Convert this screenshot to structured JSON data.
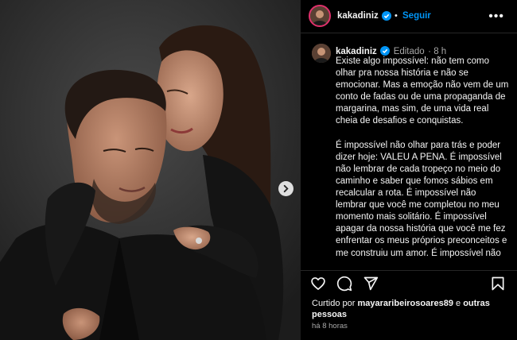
{
  "post": {
    "username": "kakadiniz",
    "follow_label": "Seguir",
    "more_label": "•••",
    "edited_label": "Editado",
    "time_ago": "8 h",
    "caption": "Existe algo impossível: não tem como olhar pra nossa história e não se emocionar. Mas a emoção não vem de um conto de fadas ou de uma propaganda de margarina, mas sim, de uma vida real cheia de desafios e conquistas.\n\nÉ impossível não olhar para trás e poder dizer hoje: VALEU A PENA. É impossível não lembrar de cada tropeço no meio do caminho e saber que fomos sábios em recalcular a rota. É impossível não lembrar que você me completou no meu momento mais solitário. É impossível apagar da nossa história que você me fez enfrentar os meus próprios preconceitos e me construiu um amor. É impossível não"
  },
  "likes": {
    "prefix": "Curtido por ",
    "user": "mayararibeirosoares89",
    "middle": " e ",
    "others": "outras pessoas"
  },
  "timestamp": "há 8 horas",
  "colors": {
    "accent": "#0095f6",
    "verified": "#0095f6",
    "secondary_text": "#a8a8a8"
  },
  "icons": [
    "heart-icon",
    "comment-icon",
    "share-icon",
    "bookmark-icon",
    "chevron-right-icon",
    "verified-icon",
    "more-icon"
  ]
}
